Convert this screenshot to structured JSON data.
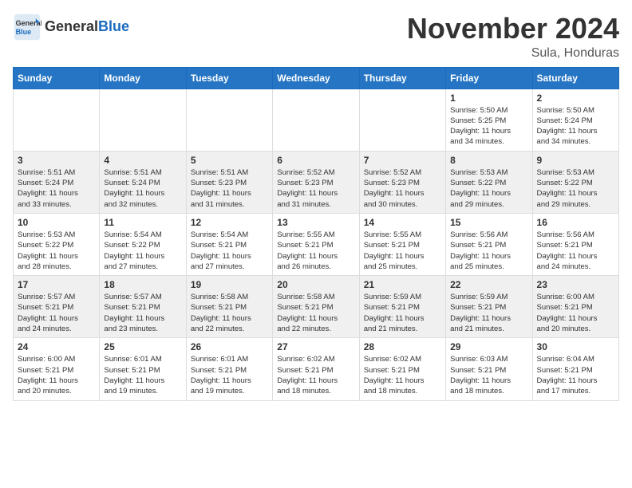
{
  "header": {
    "logo_line1": "General",
    "logo_line2": "Blue",
    "month_title": "November 2024",
    "location": "Sula, Honduras"
  },
  "days_of_week": [
    "Sunday",
    "Monday",
    "Tuesday",
    "Wednesday",
    "Thursday",
    "Friday",
    "Saturday"
  ],
  "weeks": [
    [
      {
        "day": "",
        "info": ""
      },
      {
        "day": "",
        "info": ""
      },
      {
        "day": "",
        "info": ""
      },
      {
        "day": "",
        "info": ""
      },
      {
        "day": "",
        "info": ""
      },
      {
        "day": "1",
        "info": "Sunrise: 5:50 AM\nSunset: 5:25 PM\nDaylight: 11 hours\nand 34 minutes."
      },
      {
        "day": "2",
        "info": "Sunrise: 5:50 AM\nSunset: 5:24 PM\nDaylight: 11 hours\nand 34 minutes."
      }
    ],
    [
      {
        "day": "3",
        "info": "Sunrise: 5:51 AM\nSunset: 5:24 PM\nDaylight: 11 hours\nand 33 minutes."
      },
      {
        "day": "4",
        "info": "Sunrise: 5:51 AM\nSunset: 5:24 PM\nDaylight: 11 hours\nand 32 minutes."
      },
      {
        "day": "5",
        "info": "Sunrise: 5:51 AM\nSunset: 5:23 PM\nDaylight: 11 hours\nand 31 minutes."
      },
      {
        "day": "6",
        "info": "Sunrise: 5:52 AM\nSunset: 5:23 PM\nDaylight: 11 hours\nand 31 minutes."
      },
      {
        "day": "7",
        "info": "Sunrise: 5:52 AM\nSunset: 5:23 PM\nDaylight: 11 hours\nand 30 minutes."
      },
      {
        "day": "8",
        "info": "Sunrise: 5:53 AM\nSunset: 5:22 PM\nDaylight: 11 hours\nand 29 minutes."
      },
      {
        "day": "9",
        "info": "Sunrise: 5:53 AM\nSunset: 5:22 PM\nDaylight: 11 hours\nand 29 minutes."
      }
    ],
    [
      {
        "day": "10",
        "info": "Sunrise: 5:53 AM\nSunset: 5:22 PM\nDaylight: 11 hours\nand 28 minutes."
      },
      {
        "day": "11",
        "info": "Sunrise: 5:54 AM\nSunset: 5:22 PM\nDaylight: 11 hours\nand 27 minutes."
      },
      {
        "day": "12",
        "info": "Sunrise: 5:54 AM\nSunset: 5:21 PM\nDaylight: 11 hours\nand 27 minutes."
      },
      {
        "day": "13",
        "info": "Sunrise: 5:55 AM\nSunset: 5:21 PM\nDaylight: 11 hours\nand 26 minutes."
      },
      {
        "day": "14",
        "info": "Sunrise: 5:55 AM\nSunset: 5:21 PM\nDaylight: 11 hours\nand 25 minutes."
      },
      {
        "day": "15",
        "info": "Sunrise: 5:56 AM\nSunset: 5:21 PM\nDaylight: 11 hours\nand 25 minutes."
      },
      {
        "day": "16",
        "info": "Sunrise: 5:56 AM\nSunset: 5:21 PM\nDaylight: 11 hours\nand 24 minutes."
      }
    ],
    [
      {
        "day": "17",
        "info": "Sunrise: 5:57 AM\nSunset: 5:21 PM\nDaylight: 11 hours\nand 24 minutes."
      },
      {
        "day": "18",
        "info": "Sunrise: 5:57 AM\nSunset: 5:21 PM\nDaylight: 11 hours\nand 23 minutes."
      },
      {
        "day": "19",
        "info": "Sunrise: 5:58 AM\nSunset: 5:21 PM\nDaylight: 11 hours\nand 22 minutes."
      },
      {
        "day": "20",
        "info": "Sunrise: 5:58 AM\nSunset: 5:21 PM\nDaylight: 11 hours\nand 22 minutes."
      },
      {
        "day": "21",
        "info": "Sunrise: 5:59 AM\nSunset: 5:21 PM\nDaylight: 11 hours\nand 21 minutes."
      },
      {
        "day": "22",
        "info": "Sunrise: 5:59 AM\nSunset: 5:21 PM\nDaylight: 11 hours\nand 21 minutes."
      },
      {
        "day": "23",
        "info": "Sunrise: 6:00 AM\nSunset: 5:21 PM\nDaylight: 11 hours\nand 20 minutes."
      }
    ],
    [
      {
        "day": "24",
        "info": "Sunrise: 6:00 AM\nSunset: 5:21 PM\nDaylight: 11 hours\nand 20 minutes."
      },
      {
        "day": "25",
        "info": "Sunrise: 6:01 AM\nSunset: 5:21 PM\nDaylight: 11 hours\nand 19 minutes."
      },
      {
        "day": "26",
        "info": "Sunrise: 6:01 AM\nSunset: 5:21 PM\nDaylight: 11 hours\nand 19 minutes."
      },
      {
        "day": "27",
        "info": "Sunrise: 6:02 AM\nSunset: 5:21 PM\nDaylight: 11 hours\nand 18 minutes."
      },
      {
        "day": "28",
        "info": "Sunrise: 6:02 AM\nSunset: 5:21 PM\nDaylight: 11 hours\nand 18 minutes."
      },
      {
        "day": "29",
        "info": "Sunrise: 6:03 AM\nSunset: 5:21 PM\nDaylight: 11 hours\nand 18 minutes."
      },
      {
        "day": "30",
        "info": "Sunrise: 6:04 AM\nSunset: 5:21 PM\nDaylight: 11 hours\nand 17 minutes."
      }
    ]
  ]
}
